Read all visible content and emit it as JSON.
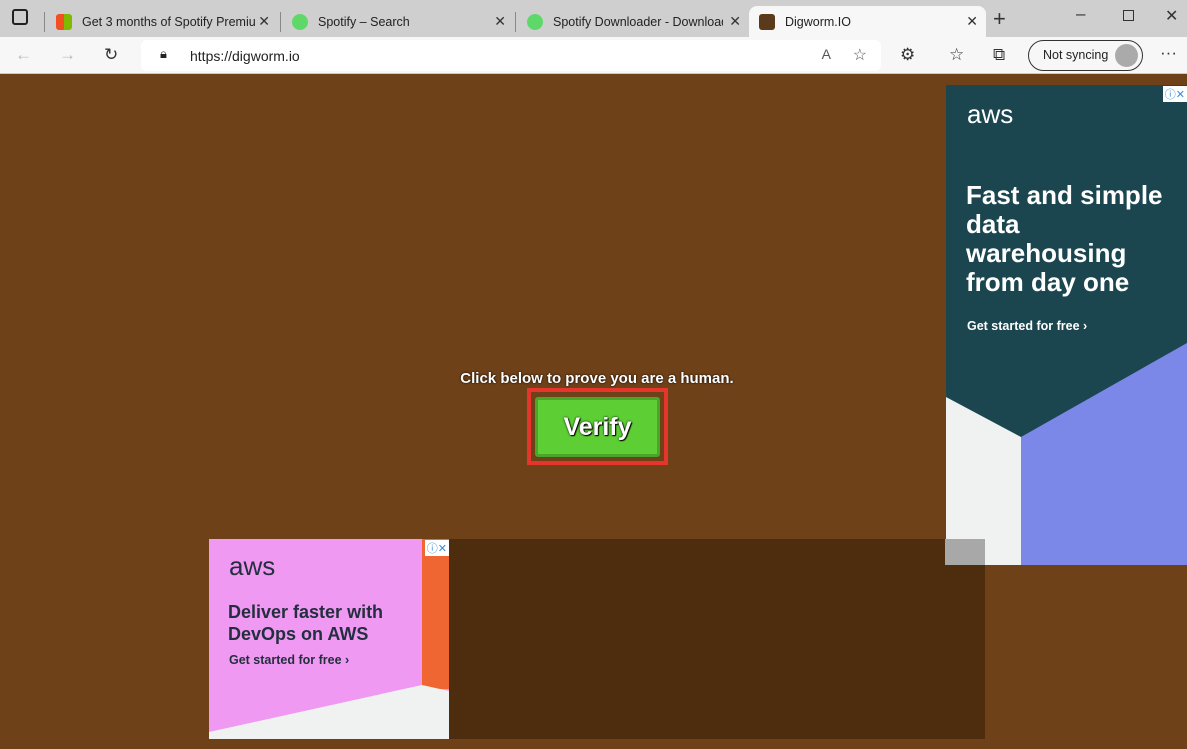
{
  "browser": {
    "tabs": [
      {
        "title": "Get 3 months of Spotify Premiu",
        "active": false
      },
      {
        "title": "Spotify – Search",
        "active": false
      },
      {
        "title": "Spotify Downloader - Download",
        "active": false
      },
      {
        "title": "Digworm.IO",
        "active": true
      }
    ],
    "url": "https://digworm.io",
    "profile_label": "Not syncing"
  },
  "page": {
    "prompt": "Click below to prove you are a human.",
    "verify_label": "Verify"
  },
  "ads": {
    "right": {
      "brand": "aws",
      "headline": "Fast and simple data warehousing from day one",
      "cta": "Get started for free ›"
    },
    "bottom": {
      "brand": "aws",
      "headline": "Deliver faster with DevOps on AWS",
      "cta": "Get started for free ›"
    }
  },
  "colors": {
    "background": "#6f4119",
    "verify_green": "#5dcf35",
    "highlight_red": "#e6352d"
  }
}
